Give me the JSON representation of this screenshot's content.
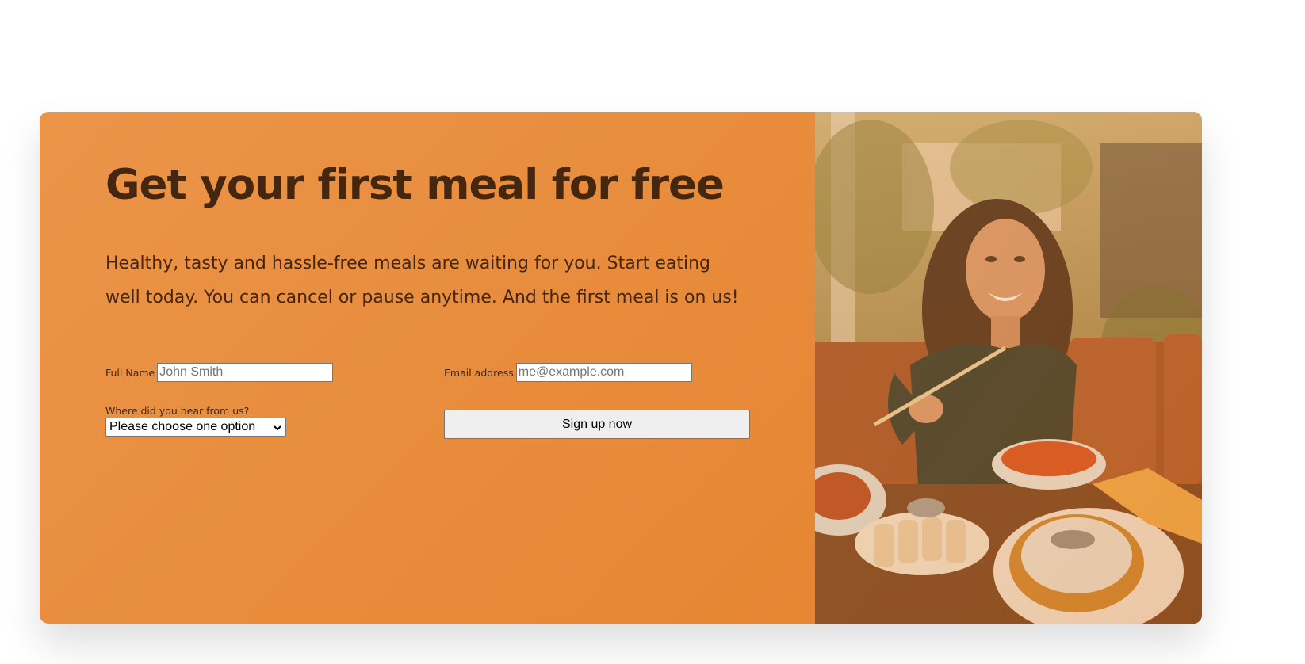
{
  "cta": {
    "heading": "Get your first meal for free",
    "description": "Healthy, tasty and hassle-free meals are waiting for you. Start eating well today. You can cancel or pause anytime. And the first meal is on us!"
  },
  "form": {
    "full_name": {
      "label": "Full Name",
      "placeholder": "John Smith",
      "value": ""
    },
    "email": {
      "label": "Email address",
      "placeholder": "me@example.com",
      "value": ""
    },
    "source": {
      "label": "Where did you hear from us?",
      "selected": "Please choose one option"
    },
    "submit_label": "Sign up now"
  },
  "image": {
    "icon": "woman-eating-photo"
  },
  "colors": {
    "card_background": "#e78a39",
    "heading_text": "#45260e"
  }
}
